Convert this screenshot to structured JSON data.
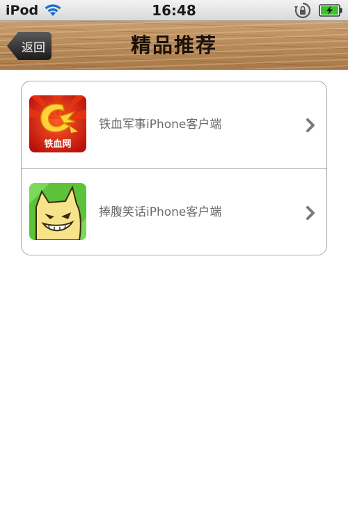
{
  "status_bar": {
    "carrier": "iPod",
    "time": "16:48",
    "icons": [
      "wifi-icon",
      "orientation-lock-icon",
      "battery-charging-icon"
    ]
  },
  "nav": {
    "back_label": "返回",
    "title": "精品推荐"
  },
  "list": {
    "items": [
      {
        "label": "铁血军事iPhone客户端",
        "icon": "tiexue-app-icon",
        "icon_text": "铁血网"
      },
      {
        "label": "捧腹笑话iPhone客户端",
        "icon": "pengfu-cat-app-icon"
      }
    ]
  },
  "colors": {
    "status_bar": "#d9d9d9",
    "nav_wood": "#b98a58",
    "back_button": "#2a2a2a",
    "label_text": "#6b6b6b",
    "tiexue_red": "#d81c12",
    "pengfu_green": "#5cc23a",
    "battery_green": "#3cc22a"
  }
}
